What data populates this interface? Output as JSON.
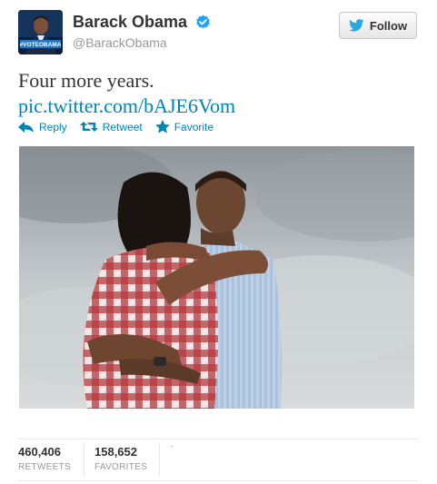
{
  "user": {
    "full_name": "Barack Obama",
    "screen_name": "@BarackObama",
    "avatar_banner": "#VOTEOBAMA",
    "verified_icon": "verified-badge-icon"
  },
  "follow_button": {
    "label": "Follow",
    "icon": "twitter-bird-icon"
  },
  "tweet": {
    "text": "Four more years.",
    "link": "pic.twitter.com/bAJE6Vom"
  },
  "actions": [
    {
      "label": "Reply",
      "icon": "reply-arrow-icon"
    },
    {
      "label": "Retweet",
      "icon": "retweet-icon"
    },
    {
      "label": "Favorite",
      "icon": "star-icon"
    }
  ],
  "stats": {
    "retweets_count": "460,406",
    "retweets_label": "RETWEETS",
    "favorites_count": "158,652",
    "favorites_label": "FAVORITES"
  },
  "colors": {
    "link": "#0084b4",
    "text": "#333333",
    "muted": "#999999",
    "verified": "#1da1f2"
  }
}
